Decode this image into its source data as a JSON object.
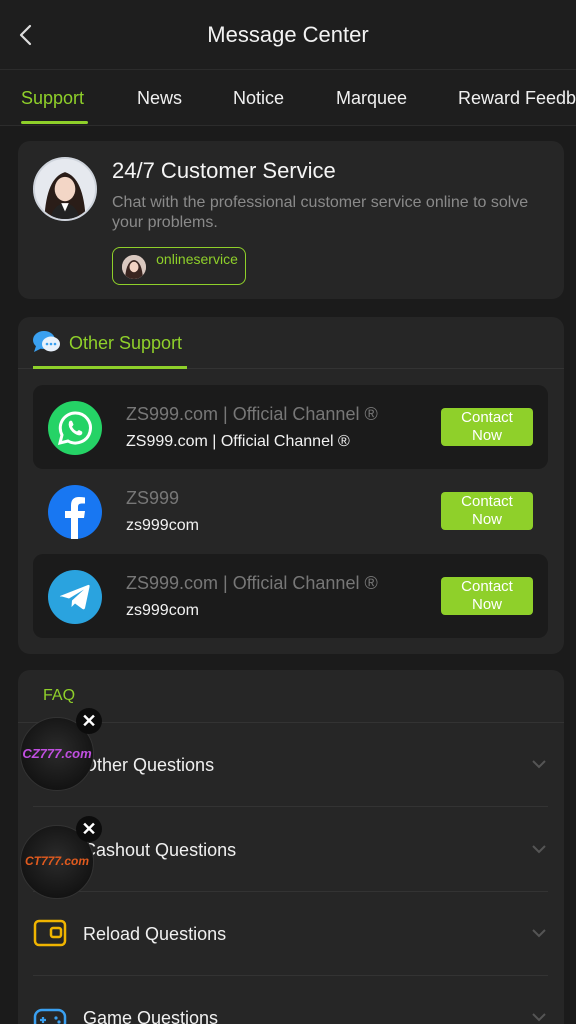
{
  "header": {
    "title": "Message Center"
  },
  "tabs": [
    {
      "label": "Support"
    },
    {
      "label": "News"
    },
    {
      "label": "Notice"
    },
    {
      "label": "Marquee"
    },
    {
      "label": "Reward Feedb"
    }
  ],
  "customer_service": {
    "title": "24/7 Customer Service",
    "description": "Chat with the professional customer service online to solve your problems.",
    "button_label": "onlineservice"
  },
  "other_support": {
    "title": "Other Support",
    "channels": [
      {
        "name": "ZS999.com | Official Channel ®",
        "handle": "ZS999.com | Official Channel ®",
        "button": "Contact Now",
        "icon": "whatsapp-icon",
        "color": "#25d366"
      },
      {
        "name": "ZS999",
        "handle": "zs999com",
        "button": "Contact Now",
        "icon": "facebook-icon",
        "color": "#1877f2"
      },
      {
        "name": "ZS999.com | Official Channel ®",
        "handle": "zs999com",
        "button": "Contact Now",
        "icon": "telegram-icon",
        "color": "#2aa3df"
      }
    ]
  },
  "faq": {
    "title": "FAQ",
    "items": [
      {
        "label": "Other Questions",
        "icon": "question-icon"
      },
      {
        "label": "Cashout Questions",
        "icon": "cashout-icon"
      },
      {
        "label": "Reload Questions",
        "icon": "wallet-icon"
      },
      {
        "label": "Game Questions",
        "icon": "gamepad-icon"
      }
    ]
  },
  "floating_ads": [
    {
      "brand": "CZ777.com",
      "close": "✕"
    },
    {
      "brand": "CT777.com",
      "close": "✕"
    }
  ],
  "colors": {
    "accent": "#8fd02a",
    "background": "#1b1b1b",
    "card": "#262626"
  }
}
